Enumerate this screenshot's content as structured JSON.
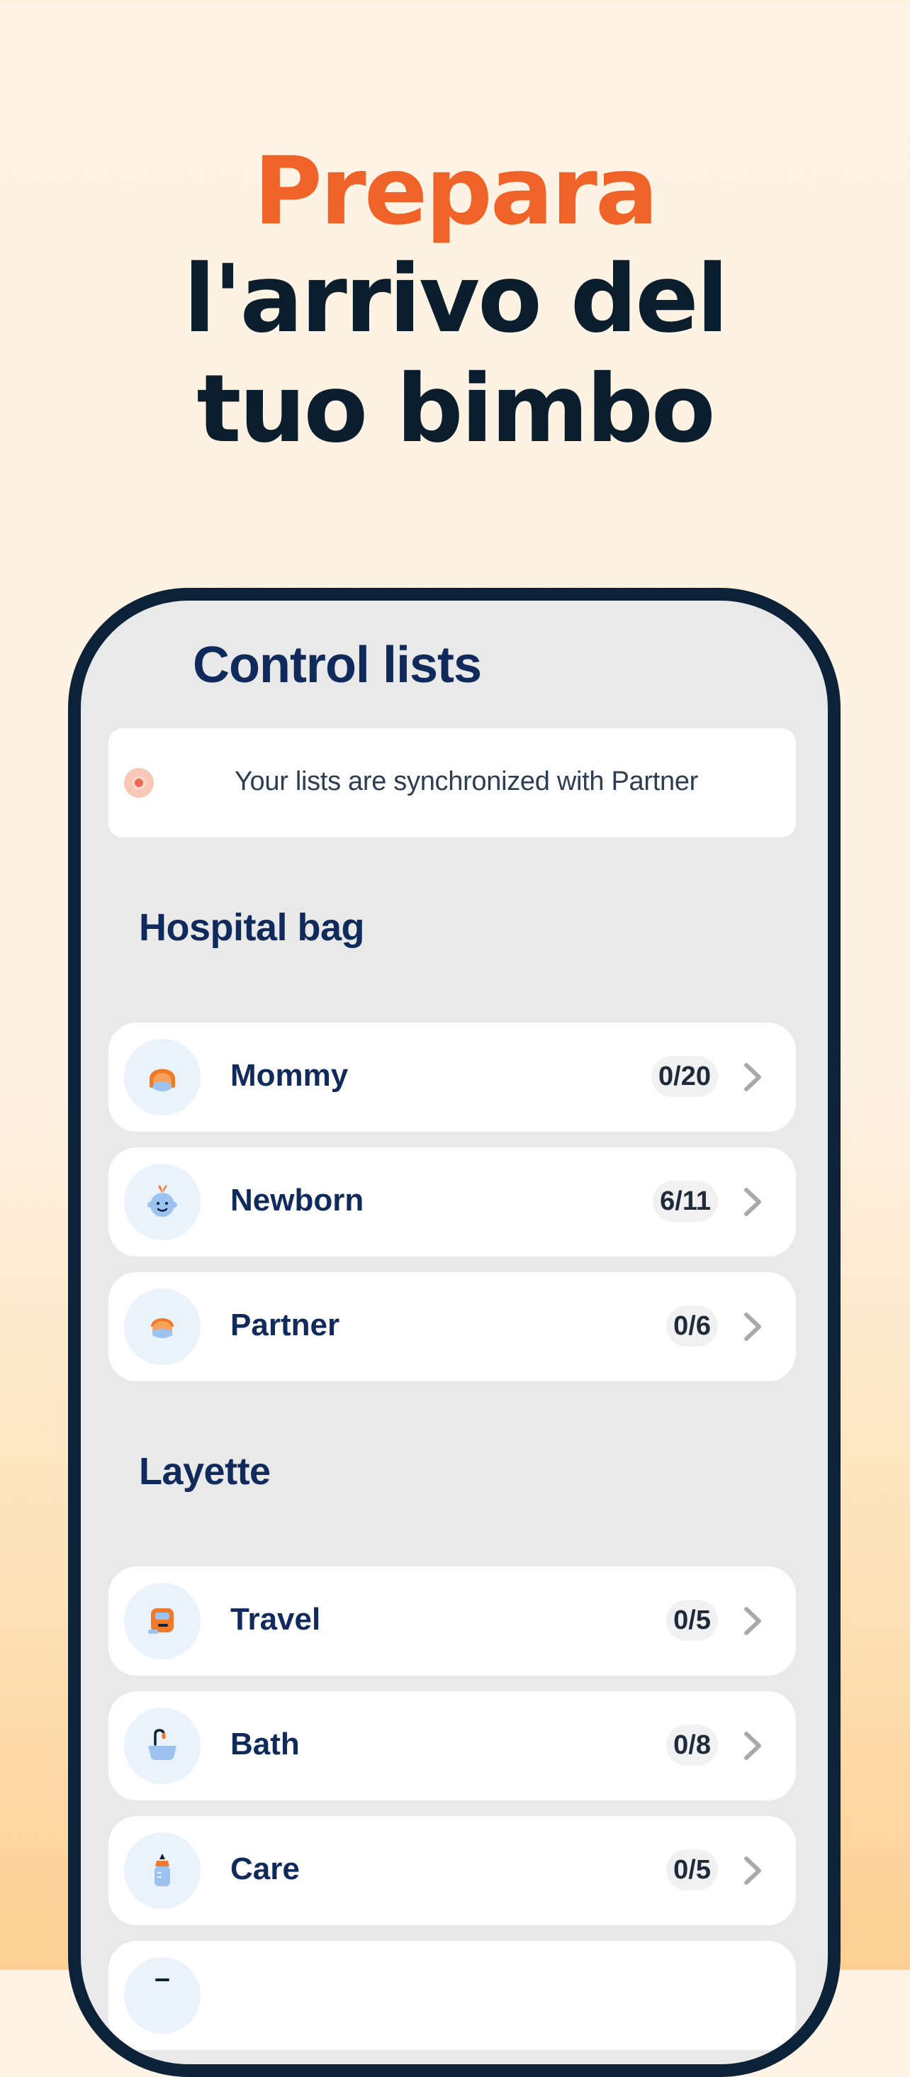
{
  "headline": {
    "line1": "Prepara",
    "line2": "l'arrivo del",
    "line3": "tuo bimbo"
  },
  "screen": {
    "title": "Control lists",
    "sync_text": "Your lists are synchronized with Partner",
    "sections": [
      {
        "title": "Hospital bag",
        "items": [
          {
            "label": "Mommy",
            "count": "0/20",
            "icon": "mom-icon"
          },
          {
            "label": "Newborn",
            "count": "6/11",
            "icon": "baby-icon"
          },
          {
            "label": "Partner",
            "count": "0/6",
            "icon": "partner-icon"
          }
        ]
      },
      {
        "title": "Layette",
        "items": [
          {
            "label": "Travel",
            "count": "0/5",
            "icon": "car-seat-icon"
          },
          {
            "label": "Bath",
            "count": "0/8",
            "icon": "bath-icon"
          },
          {
            "label": "Care",
            "count": "0/5",
            "icon": "bottle-icon"
          }
        ]
      }
    ]
  },
  "colors": {
    "accent": "#ef6228",
    "navy": "#102a5c",
    "frame": "#0b2238"
  }
}
